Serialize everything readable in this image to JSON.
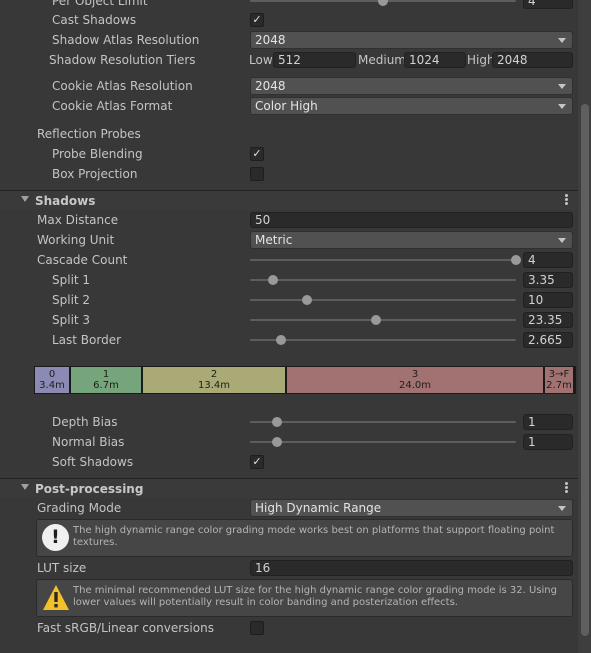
{
  "lighting": {
    "per_object_limit": {
      "label": "Per Object Limit",
      "value": "4",
      "level": 0.5
    },
    "cast_shadows": {
      "label": "Cast Shadows",
      "checked": true
    },
    "shadow_atlas_resolution": {
      "label": "Shadow Atlas Resolution",
      "value": "2048"
    },
    "shadow_resolution_tiers": {
      "label": "Shadow Resolution Tiers",
      "tiers": [
        {
          "label": "Low",
          "value": "512"
        },
        {
          "label": "Medium",
          "value": "1024"
        },
        {
          "label": "High",
          "value": "2048"
        }
      ]
    },
    "cookie_atlas_resolution": {
      "label": "Cookie Atlas Resolution",
      "value": "2048"
    },
    "cookie_atlas_format": {
      "label": "Cookie Atlas Format",
      "value": "Color High"
    },
    "reflection_probes": {
      "label": "Reflection Probes"
    },
    "probe_blending": {
      "label": "Probe Blending",
      "checked": true
    },
    "box_projection": {
      "label": "Box Projection",
      "checked": false
    }
  },
  "shadows": {
    "title": "Shadows",
    "max_distance": {
      "label": "Max Distance",
      "value": "50"
    },
    "working_unit": {
      "label": "Working Unit",
      "value": "Metric"
    },
    "cascade_count": {
      "label": "Cascade Count",
      "value": "4",
      "level": 1.0
    },
    "split1": {
      "label": "Split 1",
      "value": "3.35",
      "level": 0.086
    },
    "split2": {
      "label": "Split 2",
      "value": "10",
      "level": 0.214
    },
    "split3": {
      "label": "Split 3",
      "value": "23.35",
      "level": 0.474
    },
    "last_border": {
      "label": "Last Border",
      "value": "2.665",
      "level": 0.116
    },
    "cascades": [
      {
        "index": "0",
        "distance": "3.4m",
        "color": "#8a8ab4",
        "share": 0.067
      },
      {
        "index": "1",
        "distance": "6.7m",
        "color": "#76a57b",
        "share": 0.134
      },
      {
        "index": "2",
        "distance": "13.4m",
        "color": "#a9aa76",
        "share": 0.267
      },
      {
        "index": "3",
        "distance": "24.0m",
        "color": "#a27272",
        "share": 0.478
      },
      {
        "index": "3→F",
        "distance": "2.7m",
        "color": "#a27272",
        "share": 0.054
      }
    ],
    "depth_bias": {
      "label": "Depth Bias",
      "value": "1",
      "level": 0.1
    },
    "normal_bias": {
      "label": "Normal Bias",
      "value": "1",
      "level": 0.1
    },
    "soft_shadows": {
      "label": "Soft Shadows",
      "checked": true
    }
  },
  "post_processing": {
    "title": "Post-processing",
    "grading_mode": {
      "label": "Grading Mode",
      "value": "High Dynamic Range"
    },
    "grading_help": "The high dynamic range color grading mode works best on platforms that support floating point textures.",
    "lut_size": {
      "label": "LUT size",
      "value": "16"
    },
    "lut_warning": "The minimal recommended LUT size for the high dynamic range color grading mode is 32. Using lower values will potentially result in color banding and posterization effects.",
    "fast_srgb": {
      "label": "Fast sRGB/Linear conversions",
      "checked": false
    }
  },
  "icons": {
    "info": "info-icon",
    "warning": "warning-icon",
    "checkmark": "✓",
    "menu": "kebab-menu-icon"
  }
}
